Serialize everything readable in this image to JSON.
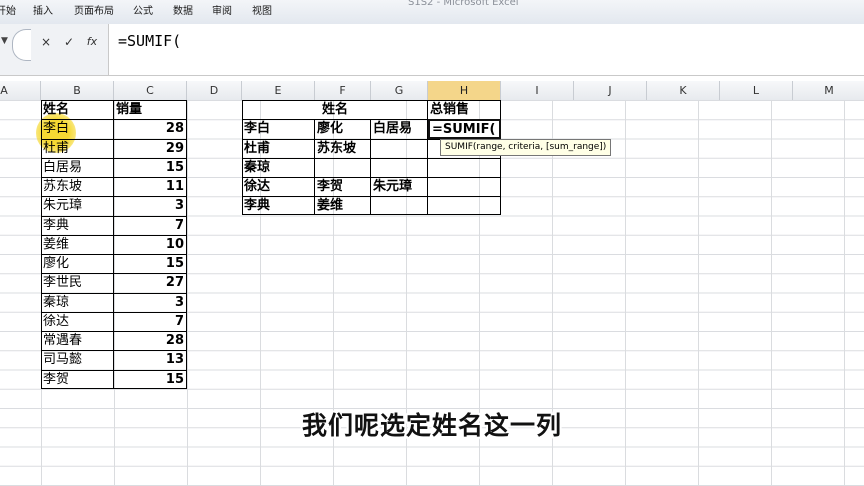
{
  "ribbon": {
    "tabs": [
      "开始",
      "插入",
      "页面布局",
      "公式",
      "数据",
      "审阅",
      "视图"
    ],
    "title_fragment": "S1S2 - Microsoft Excel"
  },
  "formula_bar": {
    "formula": "=SUMIF(",
    "buttons": {
      "cancel": "×",
      "enter": "✓",
      "function": "fx"
    }
  },
  "columns": [
    "A",
    "B",
    "C",
    "D",
    "E",
    "F",
    "G",
    "H",
    "I",
    "J",
    "K",
    "L",
    "M"
  ],
  "active_column": "H",
  "left_table": {
    "headers": [
      "姓名",
      "销量"
    ],
    "rows": [
      [
        "李白",
        "28"
      ],
      [
        "杜甫",
        "29"
      ],
      [
        "白居易",
        "15"
      ],
      [
        "苏东坡",
        "11"
      ],
      [
        "朱元璋",
        "3"
      ],
      [
        "李典",
        "7"
      ],
      [
        "姜维",
        "10"
      ],
      [
        "廖化",
        "15"
      ],
      [
        "李世民",
        "27"
      ],
      [
        "秦琼",
        "3"
      ],
      [
        "徐达",
        "7"
      ],
      [
        "常遇春",
        "28"
      ],
      [
        "司马懿",
        "13"
      ],
      [
        "李贺",
        "15"
      ]
    ]
  },
  "right_table": {
    "header_name": "姓名",
    "header_total": "总销售",
    "rows": [
      [
        "李白",
        "廖化",
        "白居易"
      ],
      [
        "杜甫",
        "苏东坡",
        ""
      ],
      [
        "秦琼",
        "",
        ""
      ],
      [
        "徐达",
        "李贺",
        "朱元璋"
      ],
      [
        "李典",
        "姜维",
        ""
      ]
    ],
    "active_cell_value": "=SUMIF("
  },
  "tooltip": "SUMIF(range, criteria, [sum_range])",
  "subtitle": "我们呢选定姓名这一列"
}
